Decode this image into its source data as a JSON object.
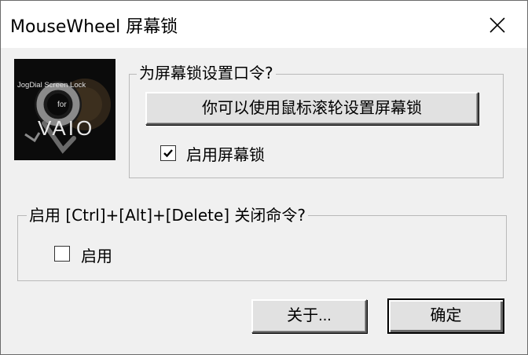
{
  "window": {
    "title": "MouseWheel 屏幕锁",
    "close_glyph": "✕"
  },
  "logo": {
    "caption": "JogDial Screen Lock",
    "for_text": "for",
    "brand": "VAIO",
    "ring_color": "#8a8a8a",
    "background_color": "#0b0b0b"
  },
  "password_group": {
    "legend": "为屏幕锁设置口令?",
    "set_button_label": "你可以使用鼠标滚轮设置屏幕锁",
    "enable_checkbox": {
      "label": "启用屏幕锁",
      "checked": true
    }
  },
  "ctrl_alt_del_group": {
    "legend": "启用 [Ctrl]+[Alt]+[Delete] 关闭命令?",
    "enable_checkbox": {
      "label": "启用",
      "checked": false
    }
  },
  "buttons": {
    "about_label": "关于...",
    "ok_label": "确定"
  }
}
